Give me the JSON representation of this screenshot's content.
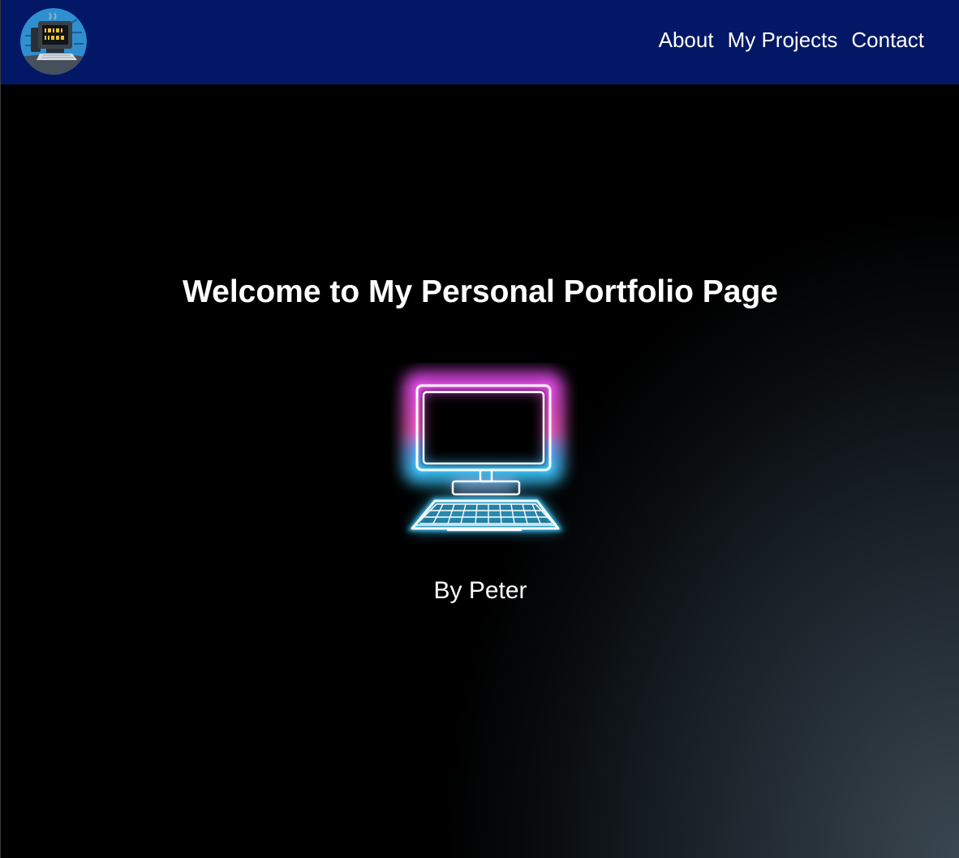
{
  "header": {
    "logo_icon": "computer-binary-logo-icon",
    "nav": [
      {
        "label": "About"
      },
      {
        "label": "My Projects"
      },
      {
        "label": "Contact"
      }
    ]
  },
  "hero": {
    "title": "Welcome to My Personal Portfolio Page",
    "image_icon": "neon-computer-icon",
    "byline": "By Peter"
  },
  "colors": {
    "navbar": "#021866",
    "background": "#000000",
    "neon_pink": "#ff4fd8",
    "neon_blue": "#38c9ff",
    "text": "#ffffff"
  }
}
